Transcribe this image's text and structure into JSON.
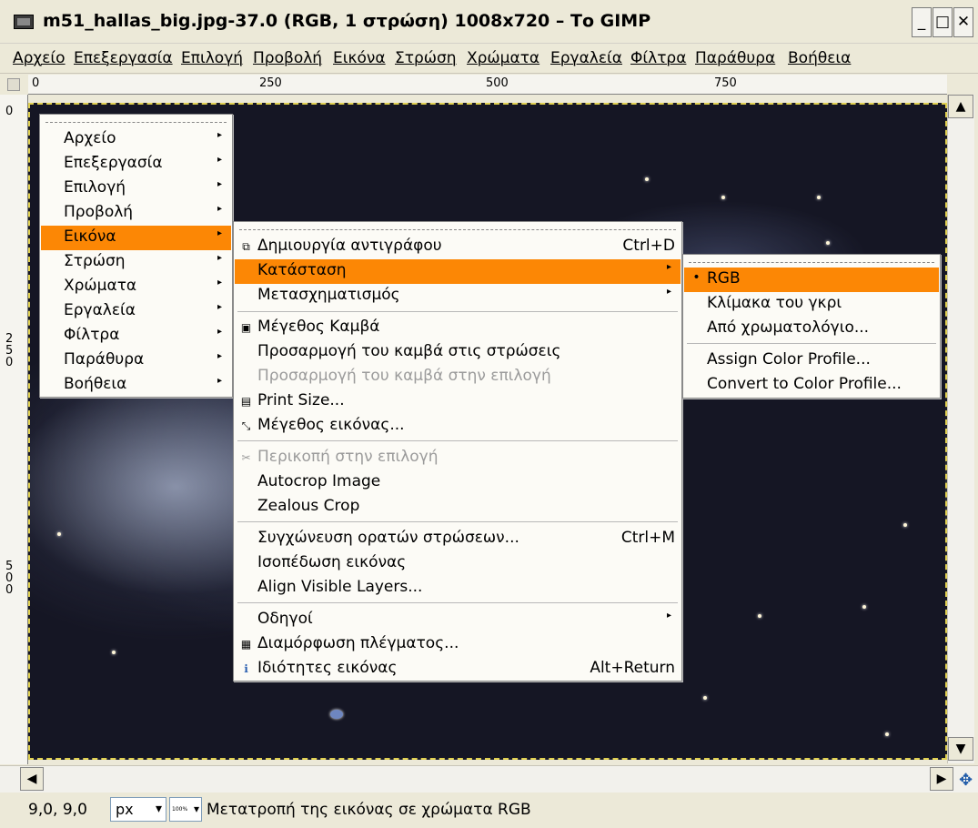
{
  "window": {
    "title": "m51_hallas_big.jpg-37.0 (RGB, 1 στρώση) 1008x720 – Το GIMP",
    "minimize": "_",
    "maximize": "□",
    "close": "✕"
  },
  "menubar": [
    "Αρχείο",
    "Επεξεργασία",
    "Επιλογή",
    "Προβολή",
    "Εικόνα",
    "Στρώση",
    "Χρώματα",
    "Εργαλεία",
    "Φίλτρα",
    "Παράθυρα",
    "Βοήθεια"
  ],
  "rulers": {
    "h_labels": [
      "0",
      "250",
      "500",
      "750"
    ],
    "v_labels": [
      "0",
      "250",
      "500"
    ]
  },
  "context_menu": {
    "items": [
      "Αρχείο",
      "Επεξεργασία",
      "Επιλογή",
      "Προβολή",
      "Εικόνα",
      "Στρώση",
      "Χρώματα",
      "Εργαλεία",
      "Φίλτρα",
      "Παράθυρα",
      "Βοήθεια"
    ],
    "highlighted": "Εικόνα"
  },
  "image_menu": {
    "duplicate": {
      "label": "Δημιουργία αντιγράφου",
      "accel": "Ctrl+D"
    },
    "mode": "Κατάσταση",
    "transform": "Μετασχηματισμός",
    "canvas_size": "Μέγεθος Καμβά",
    "fit_canvas_layers": "Προσαρμογή του καμβά στις στρώσεις",
    "fit_canvas_selection": "Προσαρμογή του καμβά στην επιλογή",
    "print_size": "Print Size...",
    "scale_image": "Μέγεθος εικόνας...",
    "crop_selection": "Περικοπή στην επιλογή",
    "autocrop": "Autocrop Image",
    "zealous_crop": "Zealous Crop",
    "merge_visible": {
      "label": "Συγχώνευση ορατών στρώσεων...",
      "accel": "Ctrl+M"
    },
    "flatten": "Ισοπέδωση εικόνας",
    "align_layers": "Align Visible Layers...",
    "guides": "Οδηγοί",
    "configure_grid": "Διαμόρφωση πλέγματος...",
    "image_properties": {
      "label": "Ιδιότητες εικόνας",
      "accel": "Alt+Return"
    }
  },
  "mode_menu": {
    "rgb": "RGB",
    "grayscale": "Κλίμακα του γκρι",
    "indexed": "Από χρωματολόγιο...",
    "assign_profile": "Assign Color Profile...",
    "convert_profile": "Convert to Color Profile...",
    "selected_bullet": "•"
  },
  "statusbar": {
    "coords": "9,0, 9,0",
    "unit": "px",
    "zoom": "100%",
    "message": "Μετατροπή της εικόνας σε χρώματα RGB"
  },
  "colors": {
    "highlight": "#fc8705",
    "canvas_bg": "#151624",
    "window_bg": "#ece9d8"
  }
}
